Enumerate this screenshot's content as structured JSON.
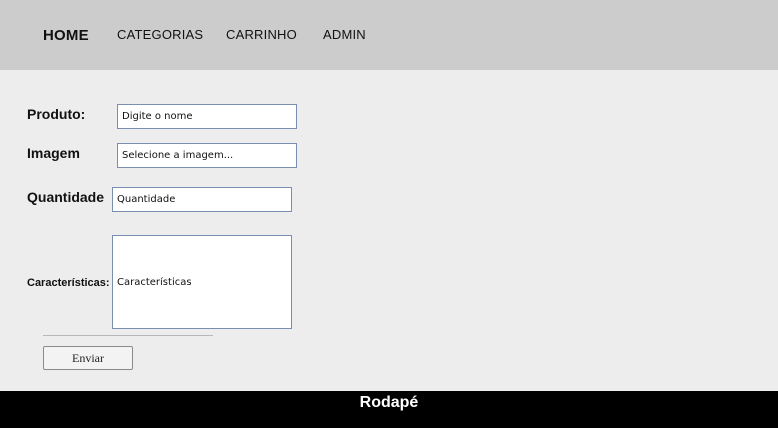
{
  "nav": {
    "home": "HOME",
    "categories": "CATEGORIAS",
    "cart": "CARRINHO",
    "admin": "ADMIN"
  },
  "form": {
    "product_label": "Produto:",
    "product_placeholder": "Digite o nome",
    "image_label": "Imagem",
    "image_placeholder": "Selecione a imagem...",
    "quantity_label": "Quantidade",
    "quantity_placeholder": "Quantidade",
    "features_label": "Características:",
    "features_placeholder": "Características",
    "submit_label": "Enviar"
  },
  "footer": {
    "text": "Rodapé"
  },
  "colors": {
    "navbar_bg": "#cccccc",
    "page_bg": "#ededed",
    "footer_bg": "#000000",
    "input_border": "#7a8fb0"
  }
}
